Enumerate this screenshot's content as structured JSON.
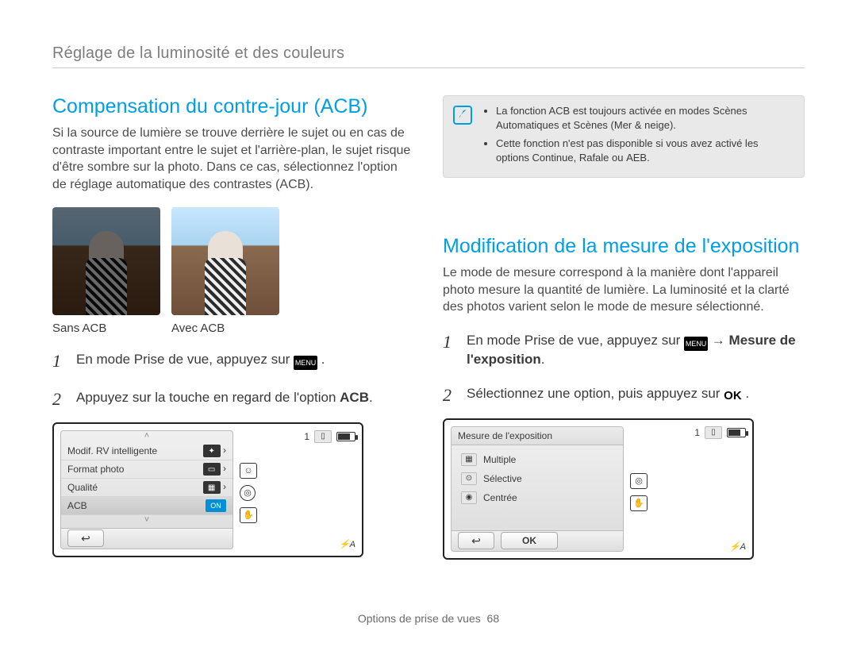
{
  "page": {
    "top_title": "Réglage de la luminosité et des couleurs",
    "footer_label": "Options de prise de vues",
    "footer_page": "68"
  },
  "left": {
    "heading": "Compensation du contre-jour (ACB)",
    "intro": "Si la source de lumière se trouve derrière le sujet ou en cas de contraste important entre le sujet et l'arrière-plan, le sujet risque d'être sombre sur la photo. Dans ce cas, sélectionnez l'option de réglage automatique des contrastes (ACB).",
    "caption_a": "Sans ACB",
    "caption_b": "Avec ACB",
    "step1": "En mode Prise de vue, appuyez sur",
    "step1_after": ".",
    "step2_a": "Appuyez sur la touche en regard de l'option ",
    "step2_b": "ACB",
    "step2_c": ".",
    "cam": {
      "rows": [
        "Modif. RV intelligente",
        "Format photo",
        "Qualité",
        "ACB"
      ],
      "on": "ON",
      "count": "1",
      "flash": "A"
    }
  },
  "right": {
    "note": {
      "li1a": "La fonction ACB est toujours activée en modes Scènes Automatiques et Scènes (",
      "li1b": "Mer & neige",
      "li1c": ").",
      "li2a": "Cette fonction n'est pas disponible si vous avez activé les options ",
      "li2b": "Continue",
      "li2c": ", ",
      "li2d": "Rafale",
      "li2e": " ou ",
      "li2f": "AEB",
      "li2g": "."
    },
    "heading": "Modification de la mesure de l'exposition",
    "intro": "Le mode de mesure correspond à la manière dont l'appareil photo mesure la quantité de lumière. La luminosité et la clarté des photos varient selon le mode de mesure sélectionné.",
    "step1_a": "En mode Prise de vue, appuyez sur",
    "step1_arrow": "→",
    "step1_b": "Mesure de l'exposition",
    "step1_c": ".",
    "step2_a": "Sélectionnez une option, puis appuyez sur ",
    "step2_ok": "OK",
    "step2_b": " .",
    "cam": {
      "title": "Mesure de l'exposition",
      "opts": [
        "Multiple",
        "Sélective",
        "Centrée"
      ],
      "ok": "OK",
      "count": "1",
      "flash": "A"
    }
  }
}
